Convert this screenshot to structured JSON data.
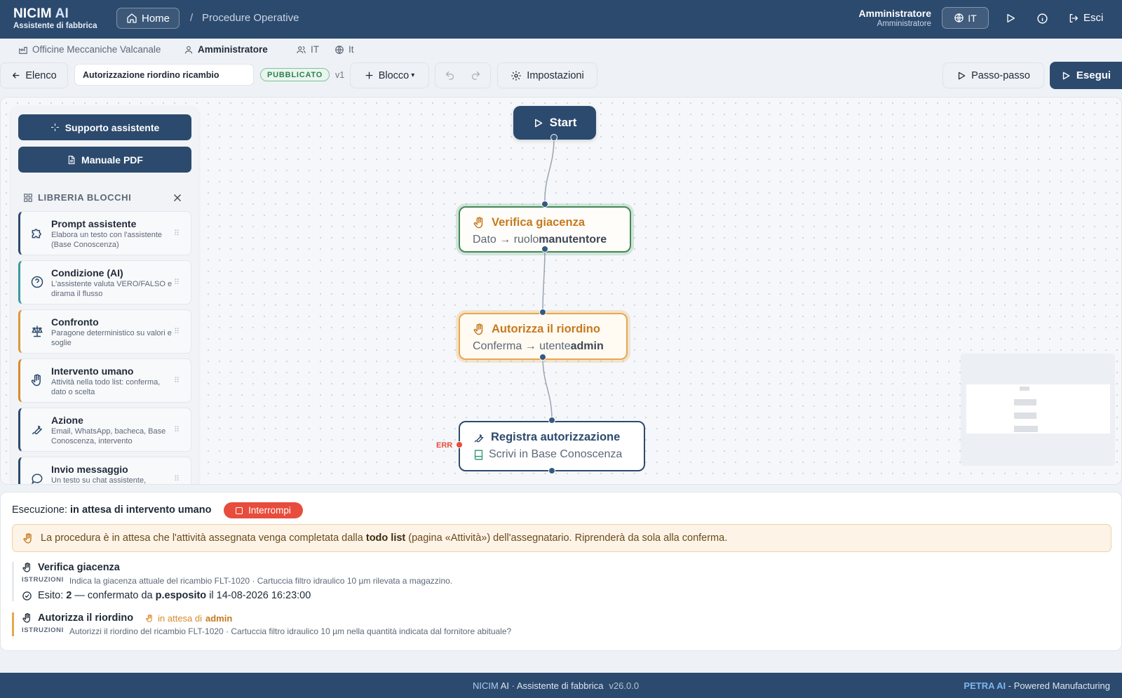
{
  "header": {
    "brand_prefix": "NICIM",
    "brand_suffix": " AI",
    "brand_sub": "Assistente di fabbrica",
    "home_label": "Home",
    "breadcrumb_sep": "/",
    "breadcrumb_page": "Procedure Operative",
    "user_name": "Amministratore",
    "user_role": "Amministratore",
    "lang": "IT",
    "logout_label": "Esci"
  },
  "subbar": {
    "company": "Officine Meccaniche Valcanale",
    "user": "Amministratore",
    "group": "IT",
    "locale": "It"
  },
  "toolbar": {
    "back_label": "Elenco",
    "procedure_title": "Autorizzazione riordino ricambio",
    "status_badge": "PUBBLICATO",
    "version": "v1",
    "block_label": "Blocco",
    "block_caret": "▾",
    "settings_label": "Impostazioni",
    "step_label": "Passo-passo",
    "run_label": "Esegui"
  },
  "panel": {
    "assistant_btn": "Supporto assistente",
    "manual_btn": "Manuale PDF",
    "library_title": "LIBRERIA BLOCCHI",
    "blocks": [
      {
        "title": "Prompt assistente",
        "desc": "Elabora un testo con l'assistente (Base Conoscenza)",
        "icon": "puzzle-icon",
        "color": "#2c4a6e"
      },
      {
        "title": "Condizione (AI)",
        "desc": "L'assistente valuta VERO/FALSO e dirama il flusso",
        "icon": "question-circle-icon",
        "color": "#3a9aa0"
      },
      {
        "title": "Confronto",
        "desc": "Paragone deterministico su valori e soglie",
        "icon": "scale-icon",
        "color": "#d99a3a"
      },
      {
        "title": "Intervento umano",
        "desc": "Attività nella todo list: conferma, dato o scelta",
        "icon": "hand-icon",
        "color": "#d98a2b"
      },
      {
        "title": "Azione",
        "desc": "Email, WhatsApp, bacheca, Base Conoscenza, intervento",
        "icon": "wrench-icon",
        "color": "#2c4a6e"
      },
      {
        "title": "Invio messaggio",
        "desc": "Un testo su chat assistente,",
        "icon": "chat-bubble-icon",
        "color": "#2c4a6e"
      }
    ]
  },
  "flow": {
    "start_label": "Start",
    "nodes": [
      {
        "title": "Verifica giacenza",
        "sub_pre": "Dato → ruolo ",
        "sub_bold": "manutentore",
        "status": "completed",
        "color": "#3f8a55",
        "title_color": "#c6791e"
      },
      {
        "title": "Autorizza il riordino",
        "sub_pre": "Conferma → utente ",
        "sub_bold": "admin",
        "status": "pending",
        "color": "#e8a64f",
        "title_color": "#c6791e"
      },
      {
        "title": "Registra autorizzazione",
        "sub_pre": "Scrivi in Base Conoscenza",
        "sub_bold": "",
        "status": "idle",
        "color": "#2c4a6e",
        "title_color": "#2c4a6e"
      }
    ],
    "err_label": "ERR"
  },
  "execution": {
    "status_prefix": "Esecuzione:",
    "status_value": "in attesa di intervento umano",
    "stop_label": "Interrompi",
    "notice_pre": "La procedura è in attesa che l'attività assegnata venga completata dalla ",
    "notice_bold": "todo list",
    "notice_post": " (pagina «Attività») dell'assegnatario. Riprenderà da sola alla conferma.",
    "steps": [
      {
        "title": "Verifica giacenza",
        "instr_label": "ISTRUZIONI",
        "instr": "Indica la giacenza attuale del ricambio FLT-1020 · Cartuccia filtro idraulico 10 µm rilevata a magazzino.",
        "result_prefix": "Esito:",
        "result_value": "2",
        "result_mid": " — confermato da ",
        "result_user": "p.esposito",
        "result_date": " il 14-08-2026 16:23:00"
      },
      {
        "title": "Autorizza il riordino",
        "pending_prefix": "in attesa di",
        "pending_user": "admin",
        "instr_label": "ISTRUZIONI",
        "instr": "Autorizzi il riordino del ricambio FLT-1020 · Cartuccia filtro idraulico 10 µm nella quantità indicata dal fornitore abituale?"
      }
    ]
  },
  "footer": {
    "brand": "NICIM",
    "brand_rest": " AI · Assistente di fabbrica",
    "version": "v26.0.0",
    "right_bold": "PETRA AI",
    "right_rest": " - Powered Manufacturing"
  }
}
